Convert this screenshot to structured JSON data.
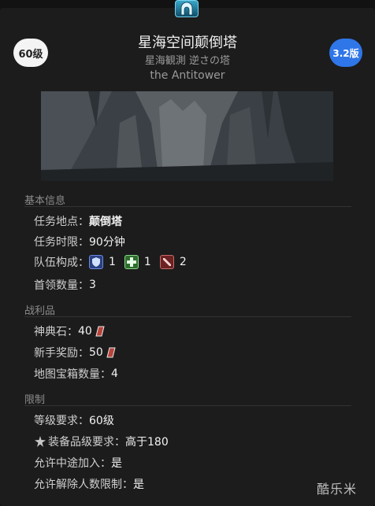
{
  "header": {
    "level_badge": "60级",
    "version_badge": "3.2版",
    "title": "星海空间颠倒塔",
    "subtitle_jp": "星海観測 逆さの塔",
    "subtitle_en": "the Antitower"
  },
  "sections": {
    "basic": {
      "title": "基本信息",
      "location_label": "任务地点：",
      "location_value": "颠倒塔",
      "time_label": "任务时限：",
      "time_value": "90分钟",
      "party_label": "队伍构成：",
      "tank_count": "1",
      "healer_count": "1",
      "dps_count": "2",
      "boss_label": "首领数量：",
      "boss_value": "3"
    },
    "loot": {
      "title": "战利品",
      "tomestone_label": "神典石：",
      "tomestone_value": "40",
      "novice_label": "新手奖励：",
      "novice_value": "50",
      "chest_label": "地图宝箱数量：",
      "chest_value": "4"
    },
    "limits": {
      "title": "限制",
      "level_label": "等级要求：",
      "level_value": "60级",
      "ilvl_label": "装备品级要求：",
      "ilvl_value": "高于180",
      "join_label": "允许中途加入：",
      "join_value": "是",
      "unrestricted_label": "允许解除人数限制：",
      "unrestricted_value": "是"
    }
  },
  "watermark": "酷乐米",
  "icons": {
    "top": "dungeon-icon",
    "tank": "shield-icon",
    "healer": "cross-icon",
    "dps": "sword-icon",
    "tomestone": "tomestone-icon",
    "ilvl": "gear-star-icon"
  },
  "colors": {
    "background": "#1c1c1c",
    "level_badge": "#f4f4f4",
    "version_badge": "#2f76e8",
    "tank": "#2a3f80",
    "healer": "#2e6d2e",
    "dps": "#6b2222"
  }
}
